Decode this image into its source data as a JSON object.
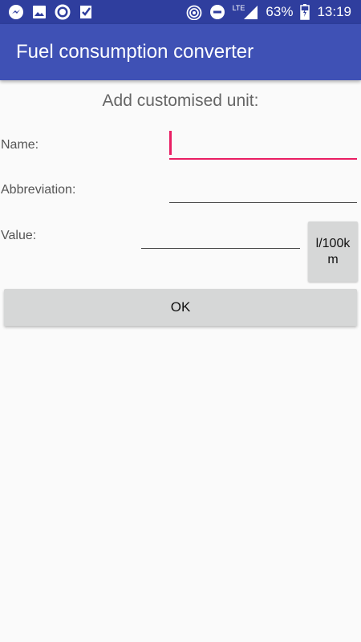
{
  "status_bar": {
    "notifications": [
      "messenger-icon",
      "image-icon",
      "circle-icon",
      "check-icon"
    ],
    "network": "LTE",
    "battery": "63%",
    "time": "13:19"
  },
  "app_bar": {
    "title": "Fuel consumption converter"
  },
  "form": {
    "heading": "Add customised unit:",
    "name_label": "Name:",
    "name_value": "",
    "abbreviation_label": "Abbreviation:",
    "abbreviation_value": "",
    "value_label": "Value:",
    "value_value": "",
    "unit_button": "l/100km",
    "ok_button": "OK"
  },
  "colors": {
    "status_bar": "#2f3e9e",
    "app_bar": "#3f51b5",
    "focus_accent": "#e91e63",
    "button_bg": "#d6d7d7",
    "background": "#fafafa"
  }
}
